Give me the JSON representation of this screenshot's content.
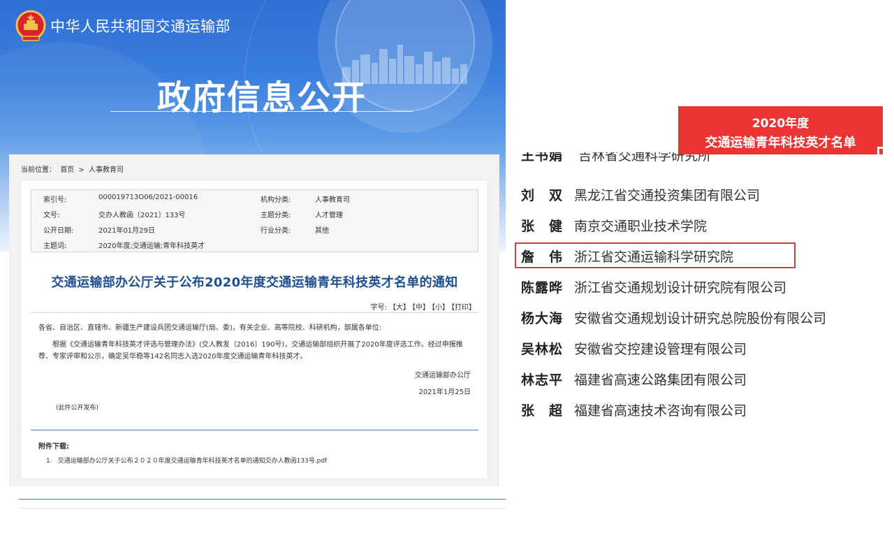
{
  "header": {
    "ministry": "中华人民共和国交通运输部",
    "section_title": "政府信息公开"
  },
  "breadcrumb": {
    "label": "当前位置：",
    "home": "首页",
    "sep": ">",
    "current": "人事教育司"
  },
  "metadata": {
    "index_label": "索引号:",
    "index_value": "000019713O06/2021-00016",
    "org_cat_label": "机构分类:",
    "org_cat_value": "人事教育司",
    "doc_no_label": "文号:",
    "doc_no_value": "交办人教函〔2021〕133号",
    "topic_cat_label": "主题分类:",
    "topic_cat_value": "人才管理",
    "date_label": "公开日期:",
    "date_value": "2021年01月29日",
    "industry_label": "行业分类:",
    "industry_value": "其他",
    "subject_label": "主题词:",
    "subject_value": "2020年度;交通运输;青年科技英才"
  },
  "document": {
    "title": "交通运输部办公厅关于公布2020年度交通运输青年科技英才名单的通知",
    "font_label": "字号:",
    "font_large": "【大】",
    "font_medium": "【中】",
    "font_small": "【小】",
    "print": "【打印】",
    "salutation": "各省、自治区、直辖市、新疆生产建设兵团交通运输厅(局、委)，有关企业、高等院校、科研机构，部属各单位:",
    "paragraph": "根据《交通运输青年科技英才评选与管理办法》(交人教发〔2016〕190号)，交通运输部组织开展了2020年度评选工作。经过申报推荐、专家评审和公示，确定吴华稳等142名同志入选2020年度交通运输青年科技英才。",
    "signature_org": "交通运输部办公厅",
    "signature_date": "2021年1月25日",
    "public_note": "(此件公开发布)"
  },
  "attachments": {
    "heading": "附件下载:",
    "items": [
      {
        "num": "1.",
        "name": "交通运输部办公厅关于公布２０２０年度交通运输青年科技英才名单的通知交办人教函133号.pdf"
      }
    ]
  },
  "talent_list": {
    "banner_line1": "2020年度",
    "banner_line2": "交通运输青年科技英才名单",
    "partial_row": {
      "name": "王书娟",
      "org": "吉林省交通科学研究所"
    },
    "rows": [
      {
        "name": "刘　双",
        "org": "黑龙江省交通投资集团有限公司",
        "highlighted": false
      },
      {
        "name": "张　健",
        "org": "南京交通职业技术学院",
        "highlighted": false
      },
      {
        "name": "詹　伟",
        "org": "浙江省交通运输科学研究院",
        "highlighted": true
      },
      {
        "name": "陈露晔",
        "org": "浙江省交通规划设计研究院有限公司",
        "highlighted": false
      },
      {
        "name": "杨大海",
        "org": "安徽省交通规划设计研究总院股份有限公司",
        "highlighted": false
      },
      {
        "name": "吴林松",
        "org": "安徽省交控建设管理有限公司",
        "highlighted": false
      },
      {
        "name": "林志平",
        "org": "福建省高速公路集团有限公司",
        "highlighted": false
      },
      {
        "name": "张　超",
        "org": "福建省高速技术咨询有限公司",
        "highlighted": false
      }
    ]
  },
  "colors": {
    "banner_blue": "#3a7fdd",
    "title_blue": "#1f4f8f",
    "red_banner": "#ec3433",
    "highlight_red": "#e03a3a"
  }
}
